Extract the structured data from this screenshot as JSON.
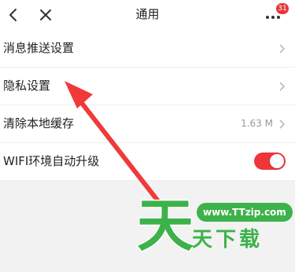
{
  "header": {
    "title": "通用",
    "back_icon": "chevron-left-icon",
    "close_icon": "close-icon",
    "more_icon": "more-dots-icon",
    "badge_count": "31"
  },
  "settings": [
    {
      "label": "消息推送设置",
      "value": "",
      "type": "link"
    },
    {
      "label": "隐私设置",
      "value": "",
      "type": "link"
    },
    {
      "label": "清除本地缓存",
      "value": "1.63 M",
      "type": "link"
    },
    {
      "label": "WIFI环境自动升级",
      "value": "",
      "type": "toggle",
      "on": true
    }
  ],
  "watermark": {
    "url": "www.TTzip.com",
    "text": "天下载",
    "logo_char": "天"
  },
  "colors": {
    "accent": "#f0353a",
    "watermark_green": "#3db24b",
    "badge": "#e5383b"
  }
}
